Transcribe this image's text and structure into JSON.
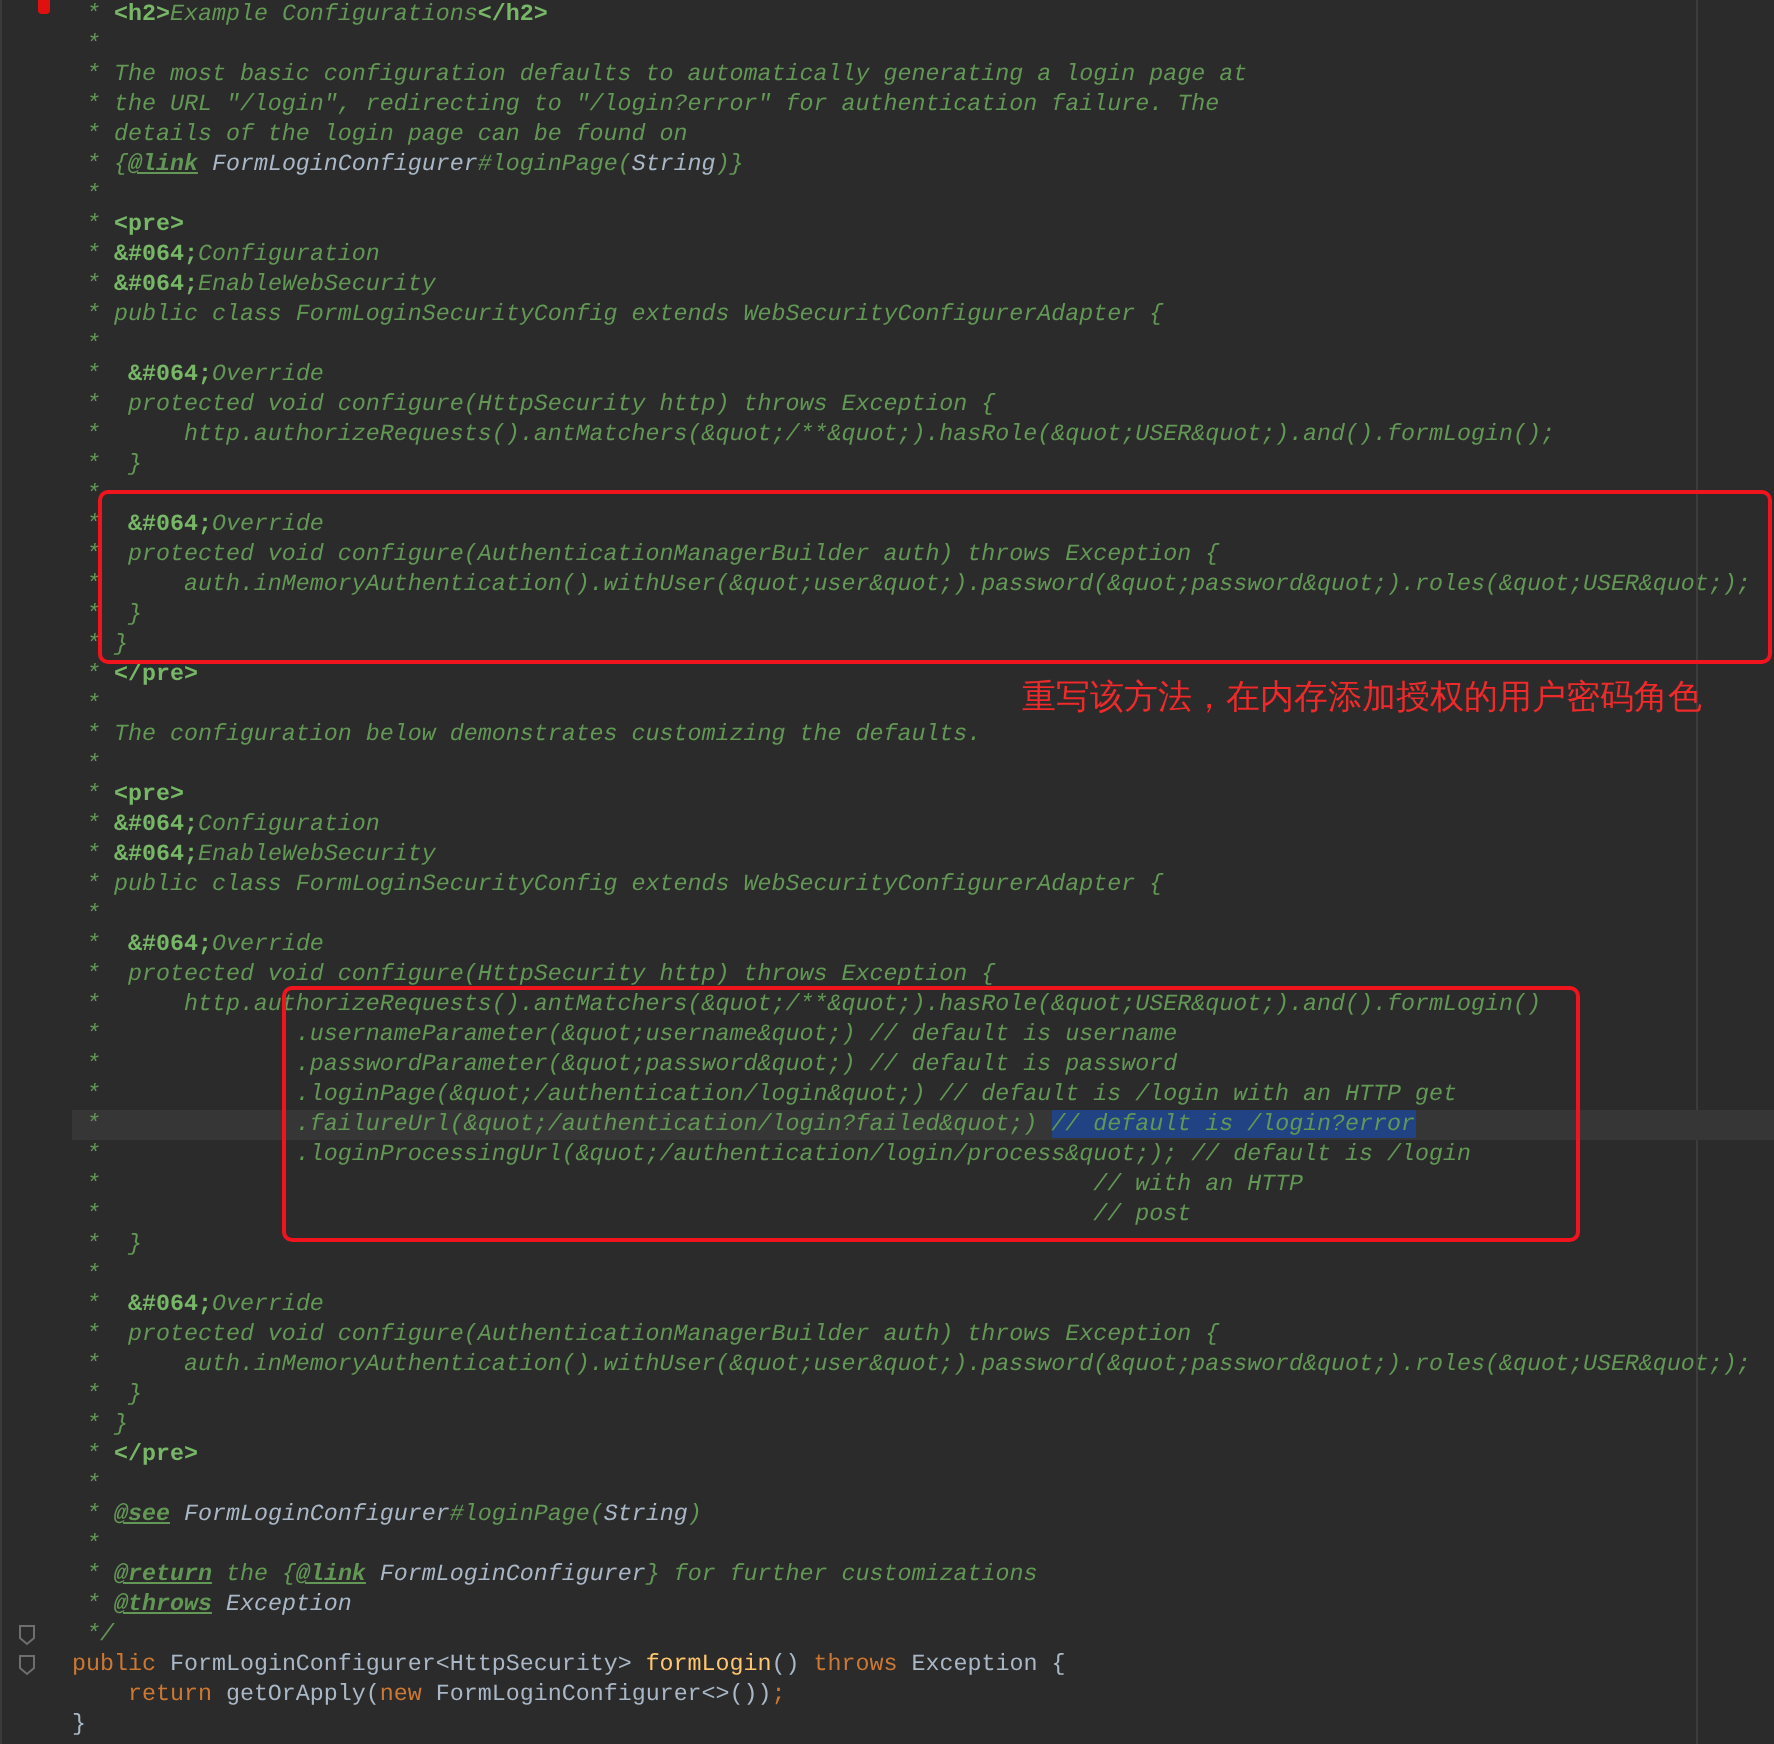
{
  "lines": [
    {
      "current": false,
      "tokens": [
        {
          "kind": "comment",
          "text": " * "
        },
        {
          "kind": "tag",
          "text": "<h2>"
        },
        {
          "kind": "comment",
          "text": "Example Configurations"
        },
        {
          "kind": "tag",
          "text": "</h2>"
        }
      ]
    },
    {
      "current": false,
      "tokens": [
        {
          "kind": "comment",
          "text": " *"
        }
      ]
    },
    {
      "current": false,
      "tokens": [
        {
          "kind": "comment",
          "text": " * The most basic configuration defaults to automatically generating a login page at"
        }
      ]
    },
    {
      "current": false,
      "tokens": [
        {
          "kind": "comment",
          "text": " * the URL \"/login\", redirecting to \"/login?error\" for authentication failure. The"
        }
      ]
    },
    {
      "current": false,
      "tokens": [
        {
          "kind": "comment",
          "text": " * details of the login page can be found on"
        }
      ]
    },
    {
      "current": false,
      "tokens": [
        {
          "kind": "comment",
          "text": " * {"
        },
        {
          "kind": "doctag",
          "text": "@link"
        },
        {
          "kind": "ref",
          "text": " FormLoginConfigurer"
        },
        {
          "kind": "comment",
          "text": "#loginPage("
        },
        {
          "kind": "ref",
          "text": "String"
        },
        {
          "kind": "comment",
          "text": ")}"
        }
      ]
    },
    {
      "current": false,
      "tokens": [
        {
          "kind": "comment",
          "text": " *"
        }
      ]
    },
    {
      "current": false,
      "tokens": [
        {
          "kind": "comment",
          "text": " * "
        },
        {
          "kind": "tag",
          "text": "<pre>"
        }
      ]
    },
    {
      "current": false,
      "tokens": [
        {
          "kind": "comment",
          "text": " * "
        },
        {
          "kind": "tag",
          "text": "&#064;"
        },
        {
          "kind": "comment",
          "text": "Configuration"
        }
      ]
    },
    {
      "current": false,
      "tokens": [
        {
          "kind": "comment",
          "text": " * "
        },
        {
          "kind": "tag",
          "text": "&#064;"
        },
        {
          "kind": "comment",
          "text": "EnableWebSecurity"
        }
      ]
    },
    {
      "current": false,
      "tokens": [
        {
          "kind": "comment",
          "text": " * public class FormLoginSecurityConfig extends WebSecurityConfigurerAdapter {"
        }
      ]
    },
    {
      "current": false,
      "tokens": [
        {
          "kind": "comment",
          "text": " *"
        }
      ]
    },
    {
      "current": false,
      "tokens": [
        {
          "kind": "comment",
          "text": " *  "
        },
        {
          "kind": "tag",
          "text": "&#064;"
        },
        {
          "kind": "comment",
          "text": "Override"
        }
      ]
    },
    {
      "current": false,
      "tokens": [
        {
          "kind": "comment",
          "text": " *  protected void configure(HttpSecurity http) throws Exception {"
        }
      ]
    },
    {
      "current": false,
      "tokens": [
        {
          "kind": "comment",
          "text": " *      http.authorizeRequests().antMatchers(&quot;/**&quot;).hasRole(&quot;USER&quot;).and().formLogin();"
        }
      ]
    },
    {
      "current": false,
      "tokens": [
        {
          "kind": "comment",
          "text": " *  }"
        }
      ]
    },
    {
      "current": false,
      "tokens": [
        {
          "kind": "comment",
          "text": " *"
        }
      ]
    },
    {
      "current": false,
      "tokens": [
        {
          "kind": "comment",
          "text": " *  "
        },
        {
          "kind": "tag",
          "text": "&#064;"
        },
        {
          "kind": "comment",
          "text": "Override"
        }
      ]
    },
    {
      "current": false,
      "tokens": [
        {
          "kind": "comment",
          "text": " *  protected void configure(AuthenticationManagerBuilder auth) throws Exception {"
        }
      ]
    },
    {
      "current": false,
      "tokens": [
        {
          "kind": "comment",
          "text": " *      auth.inMemoryAuthentication().withUser(&quot;user&quot;).password(&quot;password&quot;).roles(&quot;USER&quot;);"
        }
      ]
    },
    {
      "current": false,
      "tokens": [
        {
          "kind": "comment",
          "text": " *  }"
        }
      ]
    },
    {
      "current": false,
      "tokens": [
        {
          "kind": "comment",
          "text": " * }"
        }
      ]
    },
    {
      "current": false,
      "tokens": [
        {
          "kind": "comment",
          "text": " * "
        },
        {
          "kind": "tag",
          "text": "</pre>"
        }
      ]
    },
    {
      "current": false,
      "tokens": [
        {
          "kind": "comment",
          "text": " *"
        }
      ]
    },
    {
      "current": false,
      "tokens": [
        {
          "kind": "comment",
          "text": " * The configuration below demonstrates customizing the defaults."
        }
      ]
    },
    {
      "current": false,
      "tokens": [
        {
          "kind": "comment",
          "text": " *"
        }
      ]
    },
    {
      "current": false,
      "tokens": [
        {
          "kind": "comment",
          "text": " * "
        },
        {
          "kind": "tag",
          "text": "<pre>"
        }
      ]
    },
    {
      "current": false,
      "tokens": [
        {
          "kind": "comment",
          "text": " * "
        },
        {
          "kind": "tag",
          "text": "&#064;"
        },
        {
          "kind": "comment",
          "text": "Configuration"
        }
      ]
    },
    {
      "current": false,
      "tokens": [
        {
          "kind": "comment",
          "text": " * "
        },
        {
          "kind": "tag",
          "text": "&#064;"
        },
        {
          "kind": "comment",
          "text": "EnableWebSecurity"
        }
      ]
    },
    {
      "current": false,
      "tokens": [
        {
          "kind": "comment",
          "text": " * public class FormLoginSecurityConfig extends WebSecurityConfigurerAdapter {"
        }
      ]
    },
    {
      "current": false,
      "tokens": [
        {
          "kind": "comment",
          "text": " *"
        }
      ]
    },
    {
      "current": false,
      "tokens": [
        {
          "kind": "comment",
          "text": " *  "
        },
        {
          "kind": "tag",
          "text": "&#064;"
        },
        {
          "kind": "comment",
          "text": "Override"
        }
      ]
    },
    {
      "current": false,
      "tokens": [
        {
          "kind": "comment",
          "text": " *  protected void configure(HttpSecurity http) throws Exception {"
        }
      ]
    },
    {
      "current": false,
      "tokens": [
        {
          "kind": "comment",
          "text": " *      http.authorizeRequests().antMatchers(&quot;/**&quot;).hasRole(&quot;USER&quot;).and().formLogin()"
        }
      ]
    },
    {
      "current": false,
      "tokens": [
        {
          "kind": "comment",
          "text": " *              .usernameParameter(&quot;username&quot;) // default is username"
        }
      ]
    },
    {
      "current": false,
      "tokens": [
        {
          "kind": "comment",
          "text": " *              .passwordParameter(&quot;password&quot;) // default is password"
        }
      ]
    },
    {
      "current": false,
      "tokens": [
        {
          "kind": "comment",
          "text": " *              .loginPage(&quot;/authentication/login&quot;) // default is /login with an HTTP get"
        }
      ]
    },
    {
      "current": true,
      "tokens": [
        {
          "kind": "comment",
          "text": " *              .failureUrl(&quot;/authentication/login?failed&quot;) "
        },
        {
          "kind": "selected",
          "text": "// default is /login?error"
        }
      ]
    },
    {
      "current": false,
      "tokens": [
        {
          "kind": "comment",
          "text": " *              .loginProcessingUrl(&quot;/authentication/login/process&quot;); // default is /login"
        }
      ]
    },
    {
      "current": false,
      "tokens": [
        {
          "kind": "comment",
          "text": " *                                                                       // with an HTTP"
        }
      ]
    },
    {
      "current": false,
      "tokens": [
        {
          "kind": "comment",
          "text": " *                                                                       // post"
        }
      ]
    },
    {
      "current": false,
      "tokens": [
        {
          "kind": "comment",
          "text": " *  }"
        }
      ]
    },
    {
      "current": false,
      "tokens": [
        {
          "kind": "comment",
          "text": " *"
        }
      ]
    },
    {
      "current": false,
      "tokens": [
        {
          "kind": "comment",
          "text": " *  "
        },
        {
          "kind": "tag",
          "text": "&#064;"
        },
        {
          "kind": "comment",
          "text": "Override"
        }
      ]
    },
    {
      "current": false,
      "tokens": [
        {
          "kind": "comment",
          "text": " *  protected void configure(AuthenticationManagerBuilder auth) throws Exception {"
        }
      ]
    },
    {
      "current": false,
      "tokens": [
        {
          "kind": "comment",
          "text": " *      auth.inMemoryAuthentication().withUser(&quot;user&quot;).password(&quot;password&quot;).roles(&quot;USER&quot;);"
        }
      ]
    },
    {
      "current": false,
      "tokens": [
        {
          "kind": "comment",
          "text": " *  }"
        }
      ]
    },
    {
      "current": false,
      "tokens": [
        {
          "kind": "comment",
          "text": " * }"
        }
      ]
    },
    {
      "current": false,
      "tokens": [
        {
          "kind": "comment",
          "text": " * "
        },
        {
          "kind": "tag",
          "text": "</pre>"
        }
      ]
    },
    {
      "current": false,
      "tokens": [
        {
          "kind": "comment",
          "text": " *"
        }
      ]
    },
    {
      "current": false,
      "tokens": [
        {
          "kind": "comment",
          "text": " * "
        },
        {
          "kind": "doctag",
          "text": "@see"
        },
        {
          "kind": "ref",
          "text": " FormLoginConfigurer"
        },
        {
          "kind": "comment",
          "text": "#loginPage("
        },
        {
          "kind": "ref",
          "text": "String"
        },
        {
          "kind": "comment",
          "text": ")"
        }
      ]
    },
    {
      "current": false,
      "tokens": [
        {
          "kind": "comment",
          "text": " *"
        }
      ]
    },
    {
      "current": false,
      "tokens": [
        {
          "kind": "comment",
          "text": " * "
        },
        {
          "kind": "doctag",
          "text": "@return"
        },
        {
          "kind": "comment",
          "text": " the {"
        },
        {
          "kind": "doctag",
          "text": "@link"
        },
        {
          "kind": "ref",
          "text": " FormLoginConfigurer"
        },
        {
          "kind": "comment",
          "text": "} for further customizations"
        }
      ]
    },
    {
      "current": false,
      "tokens": [
        {
          "kind": "comment",
          "text": " * "
        },
        {
          "kind": "doctag",
          "text": "@throws"
        },
        {
          "kind": "ref",
          "text": " Exception"
        }
      ]
    },
    {
      "current": false,
      "fold": true,
      "tokens": [
        {
          "kind": "comment",
          "text": " */"
        }
      ]
    },
    {
      "current": false,
      "fold": true,
      "tokens": [
        {
          "kind": "keyword",
          "text": "public"
        },
        {
          "kind": "plain",
          "text": " FormLoginConfigurer<HttpSecurity> "
        },
        {
          "kind": "method",
          "text": "formLogin"
        },
        {
          "kind": "plain",
          "text": "() "
        },
        {
          "kind": "keyword",
          "text": "throws"
        },
        {
          "kind": "plain",
          "text": " Exception {"
        }
      ]
    },
    {
      "current": false,
      "tokens": [
        {
          "kind": "keyword",
          "text": "    return"
        },
        {
          "kind": "plain",
          "text": " getOrApply("
        },
        {
          "kind": "keyword",
          "text": "new"
        },
        {
          "kind": "plain",
          "text": " FormLoginConfigurer<>())"
        },
        {
          "kind": "keyword",
          "text": ";"
        }
      ]
    },
    {
      "current": false,
      "tokens": [
        {
          "kind": "plain",
          "text": "}"
        }
      ]
    }
  ],
  "annotations": [
    {
      "kind": "box",
      "note": "重写该方法，在内存添加授权的用户密码角色"
    },
    {
      "kind": "box"
    }
  ]
}
